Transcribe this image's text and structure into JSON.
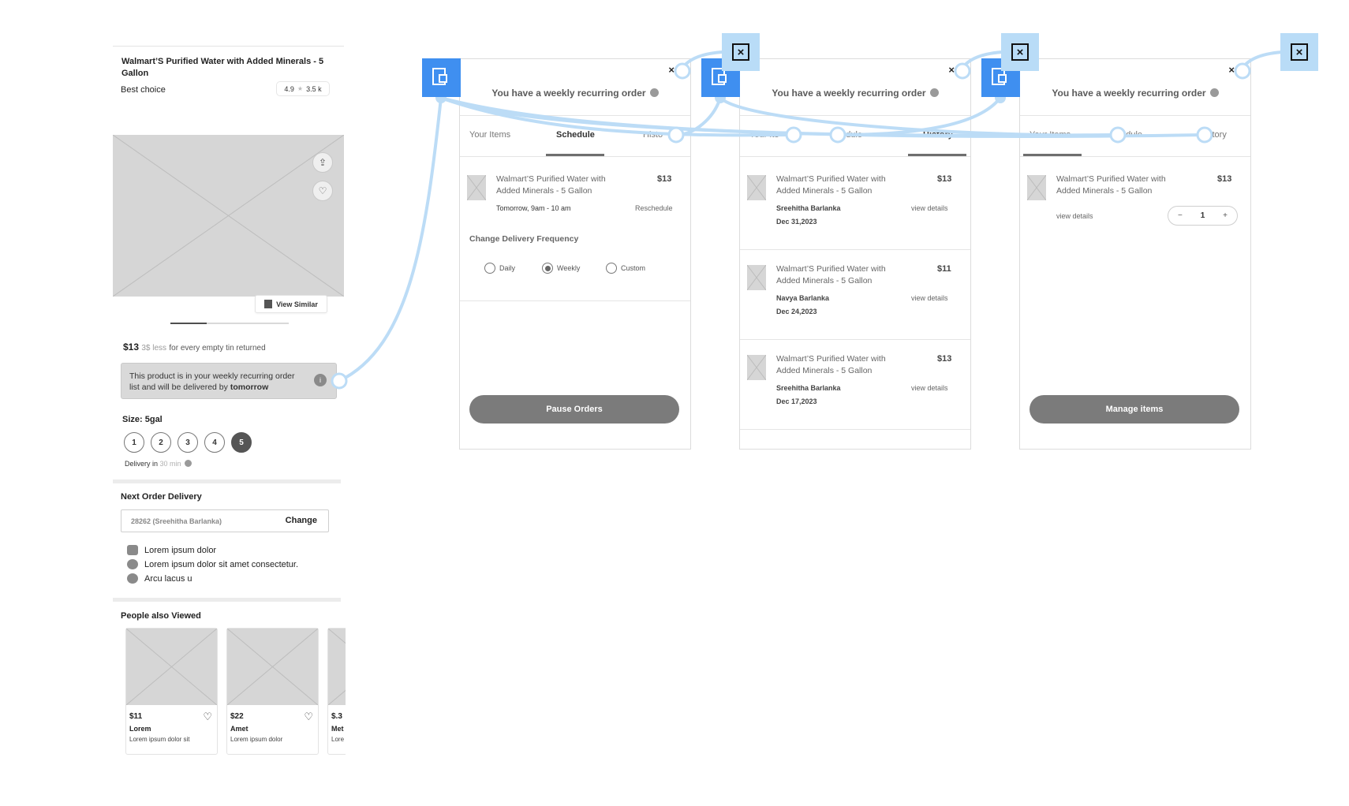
{
  "product": {
    "title": "Walmart’S Purified Water with Added Minerals - 5 Gallon",
    "badge": "Best choice",
    "rating": "4.9",
    "reviews": "3.5 k",
    "view_similar": "View Similar",
    "price": "$13",
    "discount": "3$ less",
    "discount_tail": "for every empty tin returned",
    "notice_text": "This product is in your weekly recurring order list and will be delivered by",
    "notice_bold": "tomorrow",
    "size_label": "Size: 5gal",
    "sizes": [
      "1",
      "2",
      "3",
      "4",
      "5"
    ],
    "selected_size": "5",
    "delivery_prefix": "Delivery in",
    "delivery_time": "30 min",
    "next_order_label": "Next Order Delivery",
    "address": "28262 (Sreehitha Barlanka)",
    "change_label": "Change",
    "features": [
      "Lorem ipsum dolor",
      "Lorem ipsum dolor sit amet consectetur.",
      "Arcu lacus u"
    ],
    "people_label": "People also Viewed",
    "also_viewed": [
      {
        "price": "$11",
        "name": "Lorem",
        "desc": "Lorem ipsum dolor sit"
      },
      {
        "price": "$22",
        "name": "Amet",
        "desc": "Lorem ipsum dolor"
      },
      {
        "price": "$.3",
        "name": "Met",
        "desc": "Lore"
      }
    ]
  },
  "panel_common": {
    "title": "You have a weekly recurring order",
    "close": "×",
    "tabs": [
      "Your Items",
      "Schedule",
      "History"
    ]
  },
  "schedule_panel": {
    "tab_labels": [
      "Your Items",
      "Schedule",
      "Histo"
    ],
    "item_name": "Walmart’S Purified Water with Added Minerals - 5 Gallon",
    "item_price": "$13",
    "item_time": "Tomorrow, 9am - 10 am",
    "reschedule": "Reschedule",
    "freq_label": "Change Delivery Frequency",
    "freq_options": [
      "Daily",
      "Weekly",
      "Custom"
    ],
    "freq_selected": "Weekly",
    "button": "Pause Orders"
  },
  "history_panel": {
    "tab_labels": [
      "Your Ite",
      "hedule",
      "History"
    ],
    "view_details": "view details",
    "items": [
      {
        "name": "Walmart’S Purified Water with Added Minerals - 5 Gallon",
        "price": "$13",
        "person": "Sreehitha Barlanka",
        "date": "Dec 31,2023"
      },
      {
        "name": "Walmart’S Purified Water with Added Minerals - 5 Gallon",
        "price": "$11",
        "person": "Navya Barlanka",
        "date": "Dec 24,2023"
      },
      {
        "name": "Walmart’S Purified Water with Added Minerals - 5 Gallon",
        "price": "$13",
        "person": "Sreehitha Barlanka",
        "date": "Dec 17,2023"
      }
    ]
  },
  "items_panel": {
    "tab_labels": [
      "Your Items",
      "hedule",
      "story"
    ],
    "item_name": "Walmart’S Purified Water with Added Minerals - 5 Gallon",
    "item_price": "$13",
    "view_details": "view details",
    "qty_minus": "−",
    "qty": "1",
    "qty_plus": "+",
    "button": "Manage items"
  },
  "flow": {
    "icon": "screen-link-icon",
    "close_icon": "close-box-icon",
    "close_glyph": "×",
    "accent": "#3f8ff0",
    "connector": "#bcdcf6"
  }
}
